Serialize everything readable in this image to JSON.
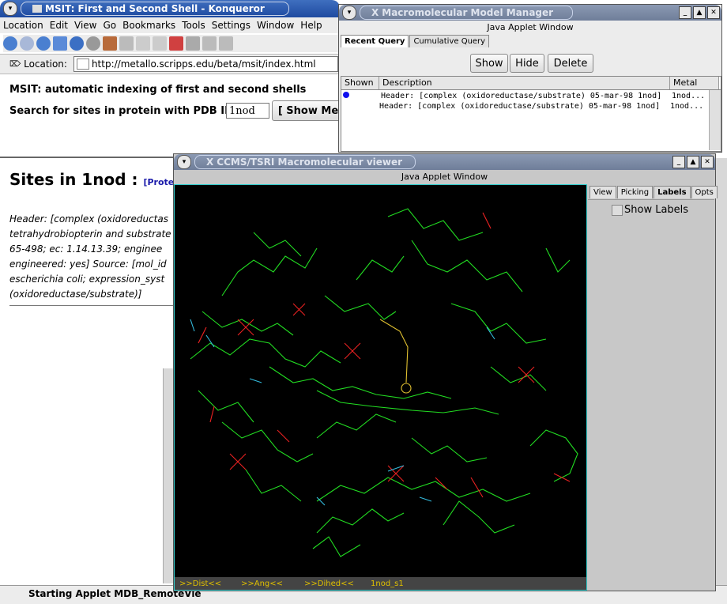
{
  "konqueror": {
    "title": "MSIT: First and Second Shell - Konqueror",
    "menu": [
      "Location",
      "Edit",
      "View",
      "Go",
      "Bookmarks",
      "Tools",
      "Settings",
      "Window",
      "Help"
    ],
    "location_label": "Location:",
    "url": "http://metallo.scripps.edu/beta/msit/index.html",
    "page_heading": "MSIT: automatic indexing of first and second shells",
    "search_label": "Search for sites in protein with PDB ID:",
    "pdb_id": "1nod",
    "show_button": "[ Show Me",
    "sites_title": "Sites in 1nod :",
    "protein_link": "[Protein e",
    "header_lines": [
      "Header: [complex (oxidoreductas",
      "tetrahydrobiopterin and substrate",
      "65-498; ec: 1.14.13.39; enginee",
      "engineered: yes] Source: [mol_id",
      "escherichia coli; expression_syst",
      "(oxidoreductase/substrate)]"
    ],
    "status": "Starting Applet MDB_RemoteVie"
  },
  "manager": {
    "title": "Macromolecular Model Manager",
    "applet_label": "Java Applet Window",
    "tabs": [
      "Recent Query",
      "Cumulative Query"
    ],
    "buttons": {
      "show": "Show",
      "hide": "Hide",
      "delete": "Delete"
    },
    "columns": {
      "shown": "Shown",
      "description": "Description",
      "metal": "Metal"
    },
    "rows": [
      {
        "description": "Header: [complex (oxidoreductase/substrate) 05-mar-98 1nod]",
        "metal": "1nod..."
      },
      {
        "description": "Header: [complex (oxidoreductase/substrate) 05-mar-98 1nod]",
        "metal": "1nod..."
      }
    ]
  },
  "viewer": {
    "title": "CCMS/TSRI Macromolecular viewer",
    "applet_label": "Java Applet Window",
    "tabs": [
      "View",
      "Picking",
      "Labels",
      "Opts"
    ],
    "show_labels": "Show Labels",
    "status_items": [
      ">>Dist<<",
      ">>Ang<<",
      ">>Dihed<<",
      "1nod_s1"
    ]
  },
  "colors": {
    "titlebar_active": "#2c58ac",
    "viewer_bg": "#000000",
    "bond_green": "#22dd22",
    "bond_red": "#ee2222",
    "bond_cyan": "#33bbdd",
    "bond_yellow": "#e0c030",
    "status_text": "#e0c000"
  }
}
